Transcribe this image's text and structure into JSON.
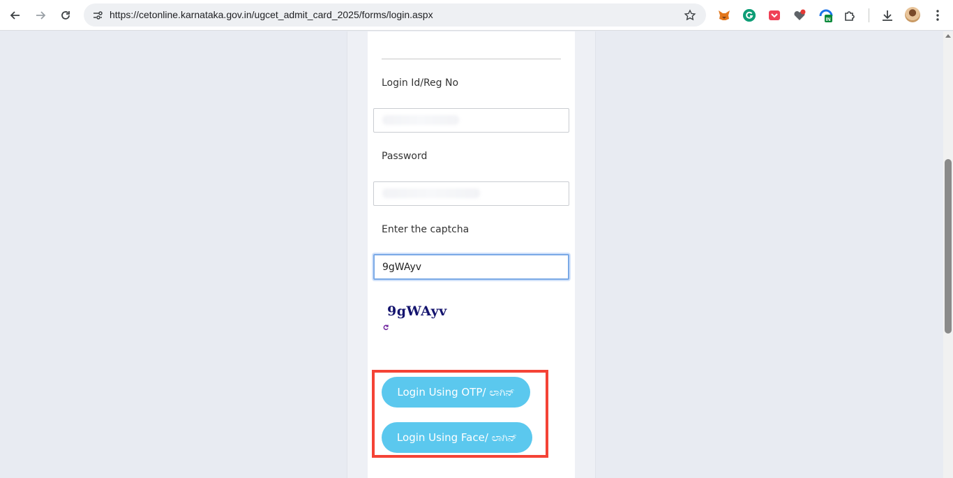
{
  "browser": {
    "url": "https://cetonline.karnataka.gov.in/ugcet_admit_card_2025/forms/login.aspx"
  },
  "form": {
    "login_label": "Login Id/Reg No",
    "password_label": "Password",
    "captcha_label": "Enter the captcha",
    "captcha_value": "9gWAyv",
    "captcha_image_text": "9gWAyv"
  },
  "buttons": {
    "otp_login": "Login Using OTP/ ಲಾಗಿನ್",
    "face_login": "Login Using Face/ ಲಾಗಿನ್"
  },
  "colors": {
    "button": "#5bc8ee",
    "highlight": "#f44336",
    "captcha_text": "#14146e"
  }
}
